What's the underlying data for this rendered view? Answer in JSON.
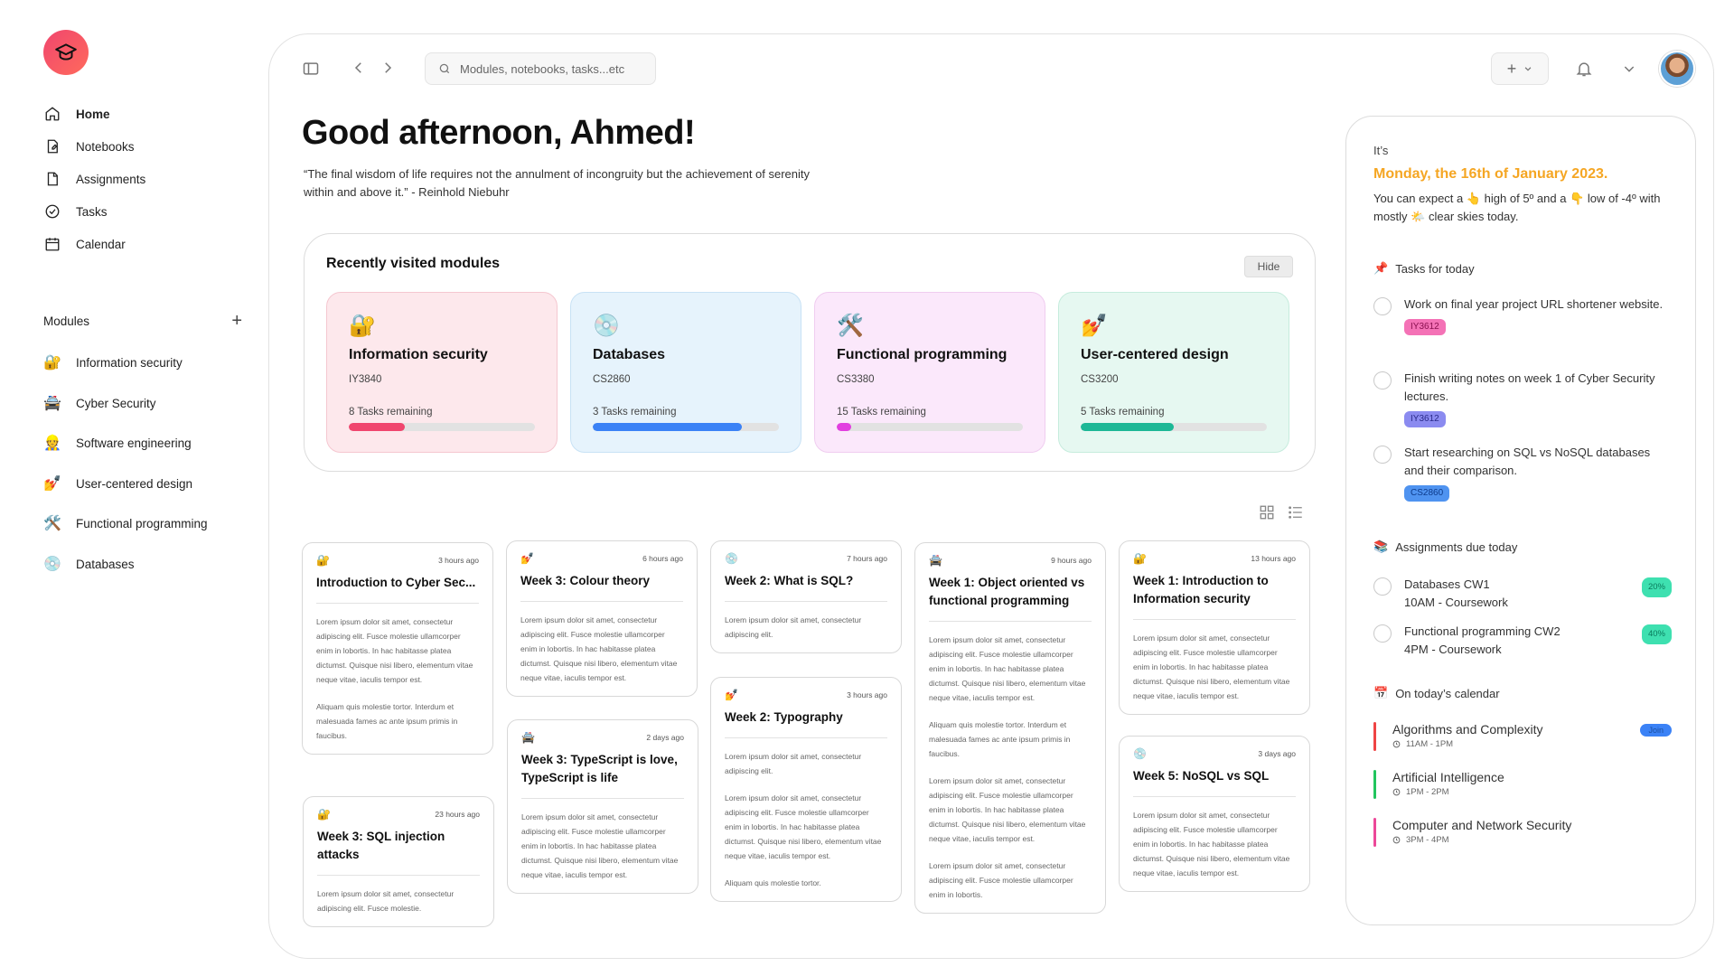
{
  "sidebar": {
    "nav": [
      {
        "label": "Home",
        "icon": "home-icon"
      },
      {
        "label": "Notebooks",
        "icon": "notebook-icon"
      },
      {
        "label": "Assignments",
        "icon": "assignment-icon"
      },
      {
        "label": "Tasks",
        "icon": "check-circle-icon"
      },
      {
        "label": "Calendar",
        "icon": "calendar-icon"
      }
    ],
    "modules_label": "Modules",
    "modules": [
      {
        "label": "Information security",
        "emoji": "🔐"
      },
      {
        "label": "Cyber Security",
        "emoji": "🚔"
      },
      {
        "label": "Software engineering",
        "emoji": "👷"
      },
      {
        "label": "User-centered design",
        "emoji": "💅"
      },
      {
        "label": "Functional programming",
        "emoji": "🛠️"
      },
      {
        "label": "Databases",
        "emoji": "💿"
      }
    ]
  },
  "topbar": {
    "search_placeholder": "Modules, notebooks, tasks...etc"
  },
  "greeting": "Good afternoon, Ahmed!",
  "quote": "“The final wisdom of life requires not the annulment of incongruity but the achievement of serenity within and above it.” - Reinhold Niebuhr",
  "recent": {
    "title": "Recently visited modules",
    "hide_label": "Hide",
    "cards": [
      {
        "emoji": "🔐",
        "name": "Information security",
        "code": "IY3840",
        "remaining": "8 Tasks remaining",
        "progress": 0.3,
        "bg": "#fde8ec",
        "border": "#f5c7d0",
        "color": "#f0466e"
      },
      {
        "emoji": "💿",
        "name": "Databases",
        "code": "CS2860",
        "remaining": "3 Tasks remaining",
        "progress": 0.8,
        "bg": "#e6f3fc",
        "border": "#c8e2f5",
        "color": "#3b82f6"
      },
      {
        "emoji": "🛠️",
        "name": "Functional programming",
        "code": "CS3380",
        "remaining": "15 Tasks remaining",
        "progress": 0.08,
        "bg": "#fbe8fb",
        "border": "#f0cdf0",
        "color": "#e23ee0"
      },
      {
        "emoji": "💅",
        "name": "User-centered design",
        "code": "CS3200",
        "remaining": "5 Tasks remaining",
        "progress": 0.5,
        "bg": "#e6f8f1",
        "border": "#c6ecdd",
        "color": "#1db896"
      }
    ]
  },
  "notes": [
    {
      "emoji": "🔐",
      "time": "3 hours ago",
      "title": "Introduction to Cyber Sec...",
      "paras": [
        "Lorem ipsum dolor sit amet, consectetur adipiscing elit. Fusce molestie ullamcorper enim in lobortis. In hac habitasse platea dictumst. Quisque nisi libero, elementum vitae neque vitae, iaculis tempor est.",
        "Aliquam quis molestie tortor. Interdum et malesuada fames ac ante ipsum primis in faucibus."
      ]
    },
    {
      "emoji": "🔐",
      "time": "23 hours ago",
      "title": "Week 3: SQL injection attacks",
      "paras": [
        "Lorem ipsum dolor sit amet, consectetur adipiscing elit. Fusce molestie."
      ]
    },
    {
      "emoji": "💅",
      "time": "6 hours ago",
      "title": "Week 3: Colour theory",
      "paras": [
        "Lorem ipsum dolor sit amet, consectetur adipiscing elit. Fusce molestie ullamcorper enim in lobortis. In hac habitasse platea dictumst. Quisque nisi libero, elementum vitae neque vitae, iaculis tempor est."
      ]
    },
    {
      "emoji": "🚔",
      "time": "2 days ago",
      "title": "Week 3: TypeScript is love, TypeScript is life",
      "paras": [
        "Lorem ipsum dolor sit amet, consectetur adipiscing elit. Fusce molestie ullamcorper enim in lobortis. In hac habitasse platea dictumst. Quisque nisi libero, elementum vitae neque vitae, iaculis tempor est."
      ]
    },
    {
      "emoji": "💿",
      "time": "7 hours ago",
      "title": "Week 2: What is SQL?",
      "paras": [
        "Lorem ipsum dolor sit amet, consectetur adipiscing elit."
      ]
    },
    {
      "emoji": "💅",
      "time": "3 hours ago",
      "title": "Week 2: Typography",
      "paras": [
        "Lorem ipsum dolor sit amet, consectetur adipiscing elit.",
        "Lorem ipsum dolor sit amet, consectetur adipiscing elit. Fusce molestie ullamcorper enim in lobortis. In hac habitasse platea dictumst. Quisque nisi libero, elementum vitae neque vitae, iaculis tempor est.",
        "Aliquam quis molestie tortor."
      ]
    },
    {
      "emoji": "🚔",
      "time": "9 hours ago",
      "title": "Week 1: Object oriented vs functional programming",
      "paras": [
        "Lorem ipsum dolor sit amet, consectetur adipiscing elit. Fusce molestie ullamcorper enim in lobortis. In hac habitasse platea dictumst. Quisque nisi libero, elementum vitae neque vitae, iaculis tempor est.",
        "Aliquam quis molestie tortor. Interdum et malesuada fames ac ante ipsum primis in faucibus.",
        "Lorem ipsum dolor sit amet, consectetur adipiscing elit. Fusce molestie ullamcorper enim in lobortis. In hac habitasse platea dictumst. Quisque nisi libero, elementum vitae neque vitae, iaculis tempor est.",
        "Lorem ipsum dolor sit amet, consectetur adipiscing elit. Fusce molestie ullamcorper enim in lobortis."
      ]
    },
    {
      "emoji": "🔐",
      "time": "13 hours ago",
      "title": "Week 1: Introduction to Information security",
      "paras": [
        "Lorem ipsum dolor sit amet, consectetur adipiscing elit. Fusce molestie ullamcorper enim in lobortis. In hac habitasse platea dictumst. Quisque nisi libero, elementum vitae neque vitae, iaculis tempor est."
      ]
    },
    {
      "emoji": "💿",
      "time": "3 days ago",
      "title": "Week 5: NoSQL vs SQL",
      "paras": [
        "Lorem ipsum dolor sit amet, consectetur adipiscing elit. Fusce molestie ullamcorper enim in lobortis. In hac habitasse platea dictumst. Quisque nisi libero, elementum vitae neque vitae, iaculis tempor est."
      ]
    }
  ],
  "right": {
    "its": "It’s",
    "date": "Monday, the 16th of January 2023.",
    "weather": "You can expect a 👆 high of 5º and a 👇 low of -4º with mostly 🌤️ clear skies today.",
    "tasks_title": "Tasks for today",
    "tasks_emoji": "📌",
    "tasks": [
      {
        "text": "Work on final year project URL shortener website.",
        "badge": "IY3612",
        "badge_bg": "#f472b6",
        "badge_fg": "#8a1050"
      },
      {
        "text": "Finish writing notes on week 1 of Cyber Security lectures.",
        "badge": "IY3612",
        "badge_bg": "#8b8bf0",
        "badge_fg": "#2a2a8a"
      },
      {
        "text": "Start researching on SQL vs NoSQL databases and their comparison.",
        "badge": "CS2860",
        "badge_bg": "#4f93f0",
        "badge_fg": "#0d3a8a"
      }
    ],
    "assign_title": "Assignments due today",
    "assign_emoji": "📚",
    "assignments": [
      {
        "name": "Databases CW1",
        "sub": "10AM - Coursework",
        "pct": "20%"
      },
      {
        "name": "Functional programming CW2",
        "sub": "4PM - Coursework",
        "pct": "40%"
      }
    ],
    "cal_title": "On today’s calendar",
    "cal_emoji": "📅",
    "calendar": [
      {
        "title": "Algorithms and Complexity",
        "time": "11AM - 1PM",
        "color": "#ef4444",
        "action": "Join"
      },
      {
        "title": "Artificial Intelligence",
        "time": "1PM - 2PM",
        "color": "#22c55e"
      },
      {
        "title": "Computer and Network Security",
        "time": "3PM - 4PM",
        "color": "#ec4899"
      }
    ]
  }
}
